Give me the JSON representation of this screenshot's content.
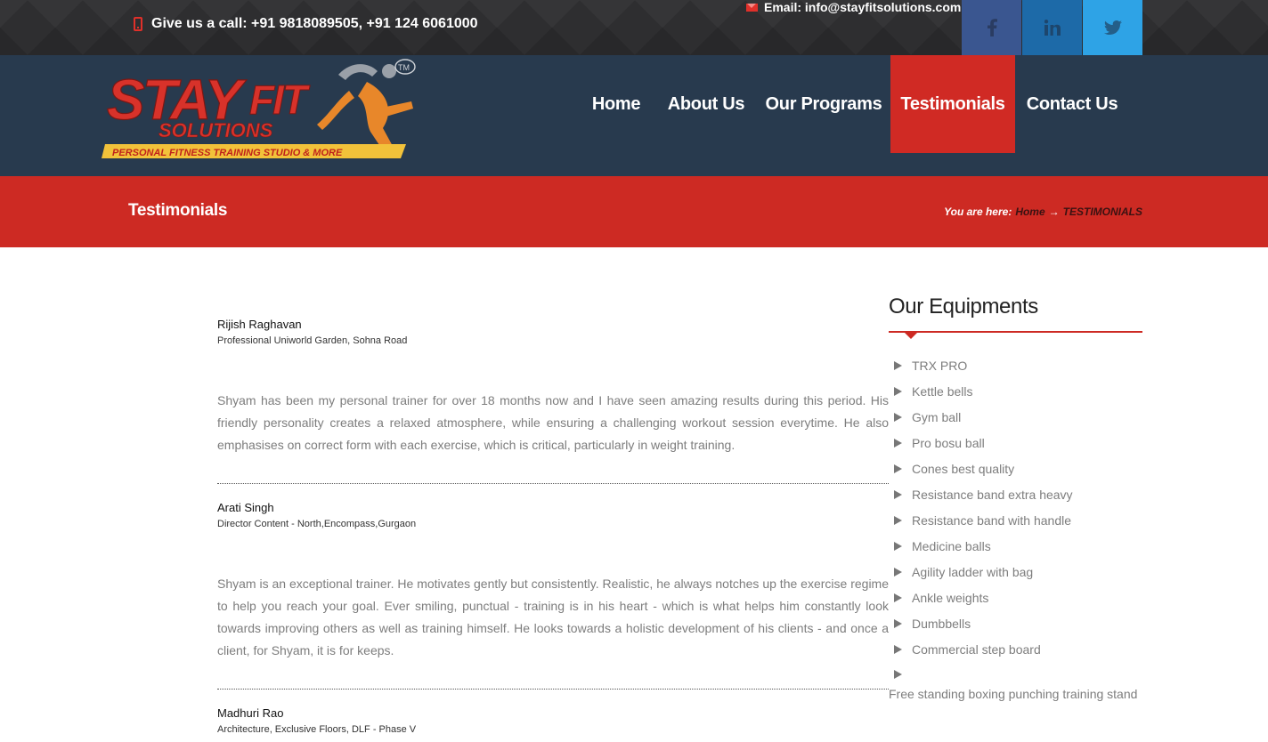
{
  "topbar": {
    "call_text": "Give us a call: +91 9818089505, +91 124 6061000",
    "email_text": "Email: info@stayfitsolutions.com",
    "social": [
      "facebook-icon",
      "linkedin-icon",
      "twitter-icon"
    ],
    "colors": {
      "facebook": "#3a5690",
      "linkedin": "#1d6aa8",
      "twitter": "#2ea3e6",
      "accent": "#e0302a"
    }
  },
  "logo": {
    "brand": "STAYFIT",
    "sub": "SOLUTIONS",
    "tagline": "PERSONAL FITNESS TRAINING STUDIO & MORE",
    "tm": "TM"
  },
  "nav": {
    "items": [
      "Home",
      "About Us",
      "Our Programs",
      "Testimonials",
      "Contact Us"
    ],
    "active": "Testimonials"
  },
  "titlebar": {
    "title": "Testimonials",
    "you_are_here": "You are here:",
    "home": "Home",
    "arrow": "→",
    "current": "TESTIMONIALS"
  },
  "testimonials": [
    {
      "name": "Rijish Raghavan",
      "role": "Professional Uniworld Garden, Sohna Road",
      "text": "Shyam has been my personal trainer for over 18 months now and I have seen amazing results during this period. His friendly personality creates a relaxed atmosphere, while ensuring a challenging workout session everytime. He also emphasises on correct form with each exercise, which is critical, particularly in weight training."
    },
    {
      "name": "Arati Singh",
      "role": "Director Content - North,Encompass,Gurgaon",
      "text": "Shyam is an exceptional trainer. He motivates gently but consistently. Realistic, he always notches up the exercise regime to help you reach your goal. Ever smiling, punctual - training is in his heart - which is what helps him constantly look towards improving others as well as training himself. He looks towards a holistic development of his clients - and once a client, for Shyam, it is for keeps."
    },
    {
      "name": "Madhuri Rao",
      "role": "Architecture, Exclusive Floors, DLF - Phase V",
      "text": ""
    }
  ],
  "sidebar": {
    "title": "Our Equipments",
    "items": [
      "TRX PRO",
      "Kettle bells",
      "Gym ball",
      "Pro bosu ball",
      "Cones best quality",
      "Resistance band extra heavy",
      "Resistance band with handle",
      "Medicine balls",
      "Agility ladder with bag",
      "Ankle weights",
      "Dumbbells",
      "Commercial step board",
      "Free standing boxing punching training stand"
    ]
  }
}
